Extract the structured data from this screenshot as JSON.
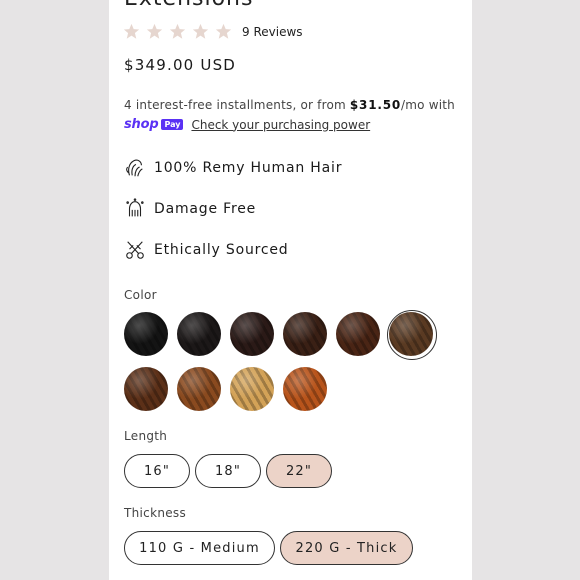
{
  "product": {
    "title": "Extensions",
    "rating_stars": 5,
    "reviews": "9 Reviews",
    "price": "$349.00 USD"
  },
  "installments": {
    "text_before": "4 interest-free installments, or from ",
    "amount": "$31.50",
    "text_after": "/mo with",
    "shop_word": "shop",
    "pay_badge": "Pay",
    "link": "Check your purchasing power"
  },
  "features": [
    {
      "label": "100% Remy Human Hair",
      "icon": "hair-icon"
    },
    {
      "label": "Damage Free",
      "icon": "head-hair-icon"
    },
    {
      "label": "Ethically Sourced",
      "icon": "scissors-icon"
    }
  ],
  "color": {
    "label": "Color",
    "swatches": [
      {
        "name": "swatch-1",
        "color": "#141414"
      },
      {
        "name": "swatch-2",
        "color": "#1c1818"
      },
      {
        "name": "swatch-3",
        "color": "#2b1a17"
      },
      {
        "name": "swatch-4",
        "color": "#3a2015"
      },
      {
        "name": "swatch-5",
        "color": "#4a2515"
      },
      {
        "name": "swatch-6",
        "color": "#5a3a22",
        "selected": true
      },
      {
        "name": "swatch-7",
        "color": "#5c3018"
      },
      {
        "name": "swatch-8",
        "color": "#8a4a1f"
      },
      {
        "name": "swatch-9",
        "color": "#d3a257"
      },
      {
        "name": "swatch-10",
        "color": "#b8541b"
      }
    ]
  },
  "length": {
    "label": "Length",
    "options": [
      "16\"",
      "18\"",
      "22\""
    ],
    "selected": "22\""
  },
  "thickness": {
    "label": "Thickness",
    "options": [
      "110 G - Medium",
      "220 G - Thick"
    ],
    "selected": "220 G - Thick"
  },
  "colors": {
    "accent": "#ecd3c8",
    "shop": "#5a31f4",
    "star": "#e6d6cf"
  }
}
